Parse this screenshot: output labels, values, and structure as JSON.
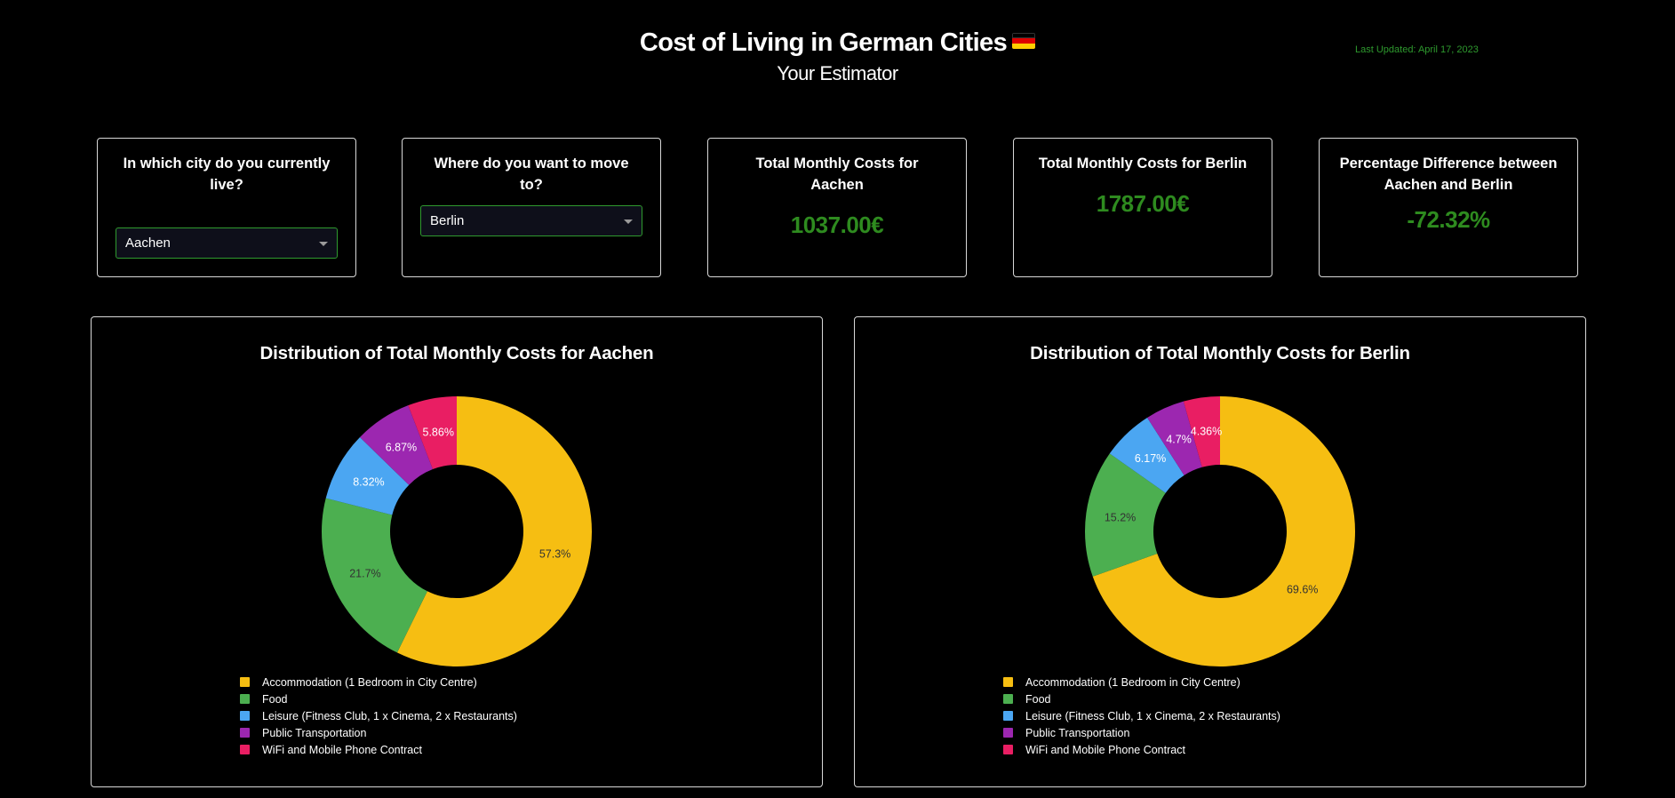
{
  "header": {
    "title": "Cost of Living in German Cities",
    "subtitle": "Your Estimator",
    "last_updated": "Last Updated: April 17, 2023"
  },
  "controls": {
    "current_city": {
      "label": "In which city do you currently live?",
      "selected": "Aachen"
    },
    "target_city": {
      "label": "Where do you want to move to?",
      "selected": "Berlin"
    }
  },
  "stats": {
    "current_total": {
      "label": "Total Monthly Costs for Aachen",
      "value": "1037.00€"
    },
    "target_total": {
      "label": "Total Monthly Costs for Berlin",
      "value": "1787.00€"
    },
    "difference": {
      "label": "Percentage Difference between Aachen and Berlin",
      "value": "-72.32%"
    }
  },
  "colors": {
    "accent_green": "#2e8b1f",
    "accommodation": "#f6be12",
    "food": "#4caf50",
    "leisure": "#4ba6f2",
    "transport": "#9c27b0",
    "wifi": "#e91e63",
    "flag": [
      "#000000",
      "#dd0000",
      "#ffce00"
    ]
  },
  "chart_data": [
    {
      "type": "pie",
      "title": "Distribution of Total Monthly Costs for Aachen",
      "categories": [
        "Accommodation (1 Bedroom in City Centre)",
        "Food",
        "Leisure (Fitness Club, 1 x Cinema, 2 x Restaurants)",
        "Public Transportation",
        "WiFi and Mobile Phone Contract"
      ],
      "values": [
        57.3,
        21.7,
        8.32,
        6.87,
        5.86
      ],
      "labels": [
        "57.3%",
        "21.7%",
        "8.32%",
        "6.87%",
        "5.86%"
      ],
      "legend": "bottom"
    },
    {
      "type": "pie",
      "title": "Distribution of Total Monthly Costs for Berlin",
      "categories": [
        "Accommodation (1 Bedroom in City Centre)",
        "Food",
        "Leisure (Fitness Club, 1 x Cinema, 2 x Restaurants)",
        "Public Transportation",
        "WiFi and Mobile Phone Contract"
      ],
      "values": [
        69.6,
        15.2,
        6.17,
        4.7,
        4.36
      ],
      "labels": [
        "69.6%",
        "15.2%",
        "6.17%",
        "4.7%",
        "4.36%"
      ],
      "legend": "bottom"
    }
  ]
}
